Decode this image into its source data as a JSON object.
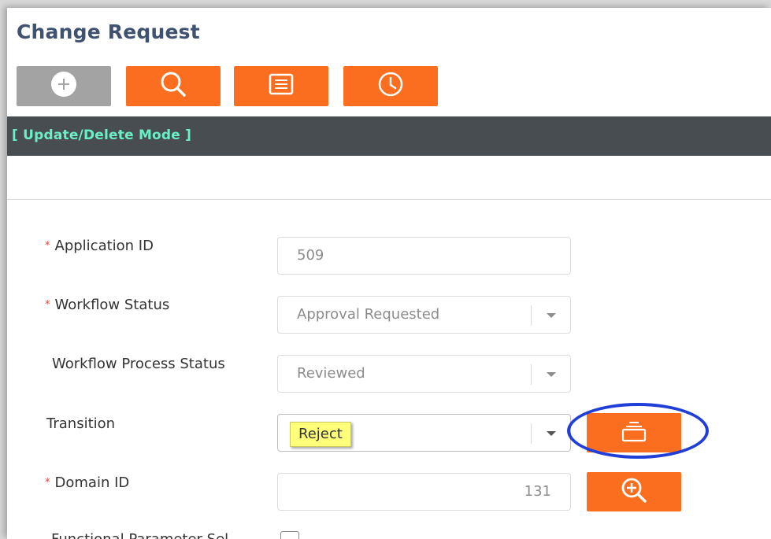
{
  "page": {
    "title": "Change Request"
  },
  "toolbar": {
    "buttons": [
      {
        "name": "add-button",
        "icon": "plus-circle-icon",
        "color": "#a3a3a3"
      },
      {
        "name": "search-button",
        "icon": "search-icon",
        "color": "#fb6e1f"
      },
      {
        "name": "list-button",
        "icon": "list-icon",
        "color": "#fb6e1f"
      },
      {
        "name": "history-button",
        "icon": "clock-icon",
        "color": "#fb6e1f"
      }
    ]
  },
  "mode": {
    "label": "[ Update/Delete Mode ]"
  },
  "form": {
    "application_id": {
      "label": "Application ID",
      "required": true,
      "value": "509"
    },
    "workflow_status": {
      "label": "Workflow Status",
      "required": true,
      "value": "Approval Requested"
    },
    "workflow_process_status": {
      "label": "Workflow Process Status",
      "required": false,
      "value": "Reviewed"
    },
    "transition": {
      "label": "Transition",
      "required": false,
      "value": "",
      "tooltip": "Reject",
      "action_icon": "window-icon"
    },
    "domain_id": {
      "label": "Domain ID",
      "required": true,
      "value": "131",
      "action_icon": "zoom-in-icon"
    },
    "partial_label": "Functional Parameter Sel..."
  },
  "colors": {
    "accent": "#fb6e1f",
    "title": "#3f5270",
    "mode_bar": "#474d50",
    "mode_text": "#6af0c4",
    "highlight": "#1f3fd8",
    "required": "#e2463b"
  }
}
